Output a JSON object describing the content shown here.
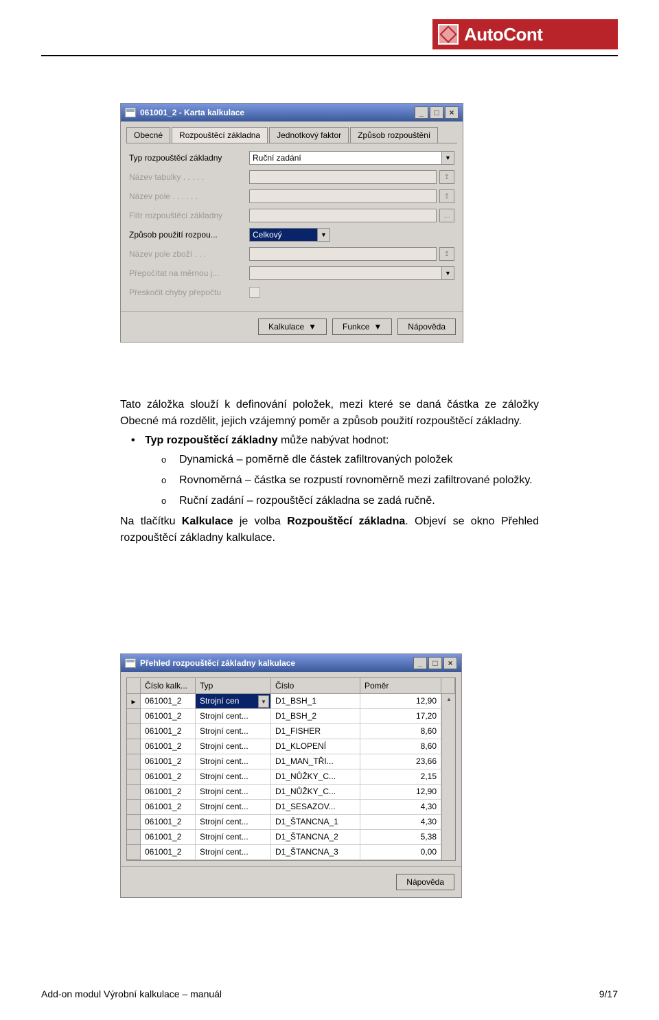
{
  "logo": {
    "text": "AutoCont"
  },
  "win1": {
    "title": "061001_2 - Karta kalkulace",
    "tabs": [
      "Obecné",
      "Rozpouštěcí základna",
      "Jednotkový faktor",
      "Způsob rozpouštění"
    ],
    "rows": {
      "r1_label": "Typ rozpouštěcí základny",
      "r1_value": "Ruční zadání",
      "r2_label": "Název tabulky . . . . .",
      "r3_label": "Název pole . . . . . .",
      "r4_label": "Filtr rozpouštěcí základny",
      "r5_label": "Způsob použití rozpou...",
      "r5_value": "Celkový",
      "r6_label": "Název pole zboží . . .",
      "r7_label": "Přepočítat na měrnou j...",
      "r8_label": "Přeskočit chyby přepočtu"
    },
    "buttons": {
      "b1": "Kalkulace",
      "b2": "Funkce",
      "b3": "Nápověda"
    }
  },
  "body": {
    "p1a": "Tato záložka slouží k definování položek, mezi které se daná částka ze záložky Obecné má rozdělit, jejich vzájemný poměr a způsob použití rozpouštěcí základny.",
    "b1a": "Typ rozpouštěcí základny",
    "b1b": " může nabývat hodnot:",
    "s1": "Dynamická – poměrně dle částek zafiltrovaných položek",
    "s2": "Rovnoměrná – částka se rozpustí rovnoměrně mezi zafiltrované položky.",
    "s3": "Ruční zadání – rozpouštěcí základna se zadá ručně.",
    "p2a": "Na tlačítku ",
    "p2b": "Kalkulace",
    "p2c": " je volba ",
    "p2d": "Rozpouštěcí základna",
    "p2e": ". Objeví se okno Přehled rozpouštěcí základny kalkulace."
  },
  "win2": {
    "title": "Přehled rozpouštěcí základny kalkulace",
    "headers": {
      "c1": "Číslo kalk...",
      "c2": "Typ",
      "c3": "Číslo",
      "c4": "Poměr"
    },
    "rows": [
      {
        "c1": "061001_2",
        "c2": "Strojní cen",
        "c3": "D1_BSH_1",
        "c4": "12,90",
        "sel": true
      },
      {
        "c1": "061001_2",
        "c2": "Strojní cent...",
        "c3": "D1_BSH_2",
        "c4": "17,20"
      },
      {
        "c1": "061001_2",
        "c2": "Strojní cent...",
        "c3": "D1_FISHER",
        "c4": "8,60"
      },
      {
        "c1": "061001_2",
        "c2": "Strojní cent...",
        "c3": "D1_KLOPENÍ",
        "c4": "8,60"
      },
      {
        "c1": "061001_2",
        "c2": "Strojní cent...",
        "c3": "D1_MAN_TŘI...",
        "c4": "23,66"
      },
      {
        "c1": "061001_2",
        "c2": "Strojní cent...",
        "c3": "D1_NŮŽKY_C...",
        "c4": "2,15"
      },
      {
        "c1": "061001_2",
        "c2": "Strojní cent...",
        "c3": "D1_NŮŽKY_C...",
        "c4": "12,90"
      },
      {
        "c1": "061001_2",
        "c2": "Strojní cent...",
        "c3": "D1_SESAZOV...",
        "c4": "4,30"
      },
      {
        "c1": "061001_2",
        "c2": "Strojní cent...",
        "c3": "D1_ŠTANCNA_1",
        "c4": "4,30"
      },
      {
        "c1": "061001_2",
        "c2": "Strojní cent...",
        "c3": "D1_ŠTANCNA_2",
        "c4": "5,38"
      },
      {
        "c1": "061001_2",
        "c2": "Strojní cent...",
        "c3": "D1_ŠTANCNA_3",
        "c4": "0,00"
      }
    ],
    "button": "Nápověda"
  },
  "footer": {
    "left": "Add-on modul Výrobní kalkulace – manuál",
    "right": "9/17"
  }
}
